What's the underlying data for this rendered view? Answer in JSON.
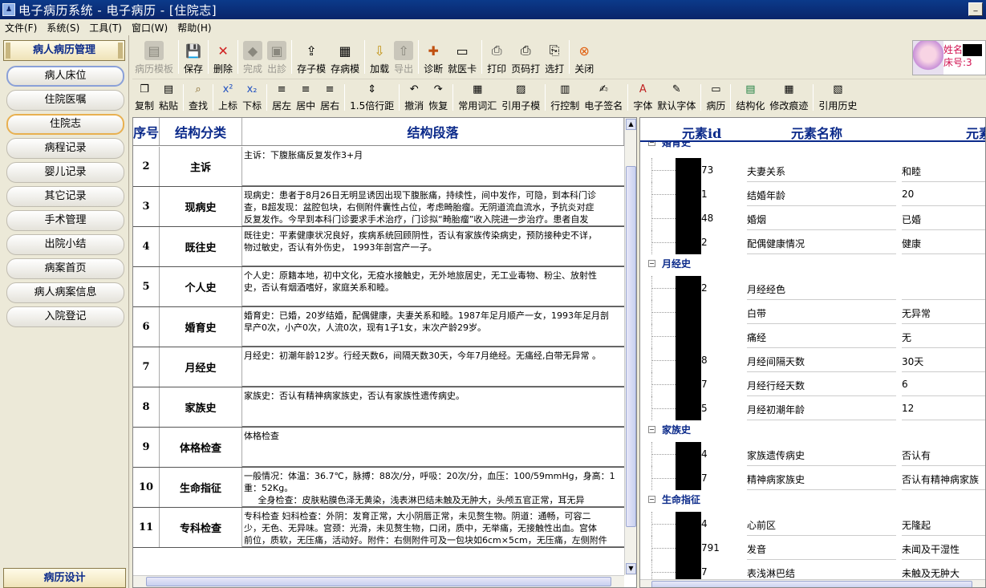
{
  "window": {
    "title": "电子病历系统 - 电子病历 - [住院志]",
    "app_icon": "app-icon"
  },
  "menu": [
    "文件(F)",
    "系统(S)",
    "工具(T)",
    "窗口(W)",
    "帮助(H)"
  ],
  "sidebar": {
    "header": "病人病历管理",
    "items": [
      {
        "label": "病人床位",
        "state": "hover"
      },
      {
        "label": "住院医嘱",
        "state": "normal"
      },
      {
        "label": "住院志",
        "state": "selected"
      },
      {
        "label": "病程记录",
        "state": "normal"
      },
      {
        "label": "婴儿记录",
        "state": "normal"
      },
      {
        "label": "其它记录",
        "state": "normal"
      },
      {
        "label": "手术管理",
        "state": "normal"
      },
      {
        "label": "出院小结",
        "state": "normal"
      },
      {
        "label": "病案首页",
        "state": "normal"
      },
      {
        "label": "病人病案信息",
        "state": "normal"
      },
      {
        "label": "入院登记",
        "state": "normal"
      }
    ],
    "footer": "病历设计"
  },
  "toolbar1": [
    {
      "label": "病历模板",
      "icon": "template-icon",
      "disabled": true
    },
    {
      "label": "保存",
      "icon": "save-icon",
      "disabled": false
    },
    {
      "label": "删除",
      "icon": "delete-icon",
      "disabled": false
    },
    {
      "label": "完成",
      "icon": "complete-icon",
      "disabled": true
    },
    {
      "label": "出診",
      "icon": "visit-icon",
      "disabled": true
    },
    {
      "label": "存子模",
      "icon": "save-subtemplate-icon",
      "disabled": false
    },
    {
      "label": "存病模",
      "icon": "save-casetemplate-icon",
      "disabled": false
    },
    {
      "label": "加载",
      "icon": "load-icon",
      "disabled": false
    },
    {
      "label": "导出",
      "icon": "export-icon",
      "disabled": true
    },
    {
      "label": "诊断",
      "icon": "diagnosis-icon",
      "disabled": false
    },
    {
      "label": "就医卡",
      "icon": "medical-card-icon",
      "disabled": false
    },
    {
      "label": "打印",
      "icon": "print-icon",
      "disabled": false
    },
    {
      "label": "页码打",
      "icon": "page-print-icon",
      "disabled": false
    },
    {
      "label": "选打",
      "icon": "select-print-icon",
      "disabled": false
    },
    {
      "label": "关闭",
      "icon": "close-icon",
      "disabled": false
    }
  ],
  "toolbar2": [
    {
      "label": "复制",
      "icon": "copy-icon"
    },
    {
      "label": "粘贴",
      "icon": "paste-icon"
    },
    {
      "label": "查找",
      "icon": "find-icon"
    },
    {
      "label": "上标",
      "icon": "superscript-icon"
    },
    {
      "label": "下标",
      "icon": "subscript-icon"
    },
    {
      "label": "居左",
      "icon": "align-left-icon"
    },
    {
      "label": "居中",
      "icon": "align-center-icon"
    },
    {
      "label": "居右",
      "icon": "align-right-icon"
    },
    {
      "label": "1.5倍行距",
      "icon": "line-spacing-icon"
    },
    {
      "label": "撤消",
      "icon": "undo-icon"
    },
    {
      "label": "恢复",
      "icon": "redo-icon"
    },
    {
      "label": "常用词汇",
      "icon": "vocabulary-icon"
    },
    {
      "label": "引用子模",
      "icon": "cite-subtemplate-icon"
    },
    {
      "label": "行控制",
      "icon": "row-control-icon"
    },
    {
      "label": "电子签名",
      "icon": "e-signature-icon"
    },
    {
      "label": "字体",
      "icon": "font-icon"
    },
    {
      "label": "默认字体",
      "icon": "default-font-icon"
    },
    {
      "label": "病历",
      "icon": "record-folder-icon"
    },
    {
      "label": "结构化",
      "icon": "structured-icon"
    },
    {
      "label": "修改痕迹",
      "icon": "revision-trace-icon"
    },
    {
      "label": "引用历史",
      "icon": "cite-history-icon"
    }
  ],
  "patient": {
    "name_label": "姓名",
    "bed_label": "床号:3"
  },
  "left_table": {
    "headers": [
      "序号",
      "结构分类",
      "结构段落"
    ],
    "rows": [
      {
        "n": "2",
        "k": "主诉",
        "t": "主诉：下腹胀痛反复发作3+月"
      },
      {
        "n": "3",
        "k": "现病史",
        "t": "现病史：患者于8月26日无明显诱因出现下腹胀痛，持续性，间中发作，可隐，到本科门诊\n查，B超发现：盆腔包块，右侧附件囊性占位，考虑畸胎瘤。无阴道流血流水，予抗炎对症\n反复发作。今早到本科门诊要求手术治疗，门诊拟“畸胎瘤”收入院进一步治疗。患者自发"
      },
      {
        "n": "4",
        "k": "既往史",
        "t": "既往史：平素健康状况良好，疾病系统回顾阴性，否认有家族传染病史，预防接种史不详，\n物过敏史，否认有外伤史， 1993年剖宫产一子。"
      },
      {
        "n": "5",
        "k": "个人史",
        "t": "个人史：原籍本地，初中文化，无疫水接触史，无外地旅居史，无工业毒物、粉尘、放射性\n史，否认有烟酒嗜好，家庭关系和睦。"
      },
      {
        "n": "6",
        "k": "婚育史",
        "t": "婚育史：已婚，20岁结婚，配偶健康，夫妻关系和睦。1987年足月顺产一女，1993年足月剖\n早产0次，小产0次，人流0次，现有1子1女，末次产龄29岁。"
      },
      {
        "n": "7",
        "k": "月经史",
        "t": "月经史：初潮年龄12岁。行经天数6，间隔天数30天，今年7月绝经。无痛经,白带无异常 。"
      },
      {
        "n": "8",
        "k": "家族史",
        "t": "家族史：否认有精神病家族史，否认有家族性遗传病史。"
      },
      {
        "n": "9",
        "k": "体格检查",
        "t": "体格检查"
      },
      {
        "n": "10",
        "k": "生命指征",
        "t": "一般情况：体温：36.7℃，脉搏：88次/分，呼吸：20次/分，血压：100/59mmHg，身高：1\n重：52Kg。\n     全身检查：皮肤粘膜色泽无黄染，浅表淋巴结未触及无肿大，头颅五官正常，耳无异"
      },
      {
        "n": "11",
        "k": "专科检查",
        "t": "专科检查 妇科检查：外阴：发育正常，大小阴唇正常，未见赘生物。阴道：通畅，可容二\n少，无色、无异味。宫颈：光滑，未见赘生物，口闭，质中，无举痛，无接触性出血。宫体\n前位，质软，无压痛，活动好。附件：右侧附件可及一包块如6cm×5cm，无压痛，左侧附件"
      }
    ]
  },
  "right_table": {
    "headers": [
      "元素id",
      "元素名称",
      "元素"
    ],
    "groups": [
      {
        "name": "婚育史",
        "items": [
          {
            "id": "73",
            "name": "夫妻关系",
            "value": "和睦"
          },
          {
            "id": "1",
            "name": "结婚年龄",
            "value": "20"
          },
          {
            "id": "48",
            "name": "婚烟",
            "value": "已婚"
          },
          {
            "id": "2",
            "name": "配偶健康情况",
            "value": "健康"
          }
        ]
      },
      {
        "name": "月经史",
        "items": [
          {
            "id": "2",
            "name": "月经经色",
            "value": ""
          },
          {
            "id": "",
            "name": "白带",
            "value": "无异常"
          },
          {
            "id": "",
            "name": "痛经",
            "value": "无"
          },
          {
            "id": "8",
            "name": "月经间隔天数",
            "value": "30天"
          },
          {
            "id": "7",
            "name": "月经行经天数",
            "value": "6"
          },
          {
            "id": "5",
            "name": "月经初潮年龄",
            "value": "12"
          }
        ]
      },
      {
        "name": "家族史",
        "items": [
          {
            "id": "4",
            "name": "家族遗传病史",
            "value": "否认有"
          },
          {
            "id": "7",
            "name": "精神病家族史",
            "value": "否认有精神病家族"
          }
        ]
      },
      {
        "name": "生命指征",
        "items": [
          {
            "id": "4",
            "name": "心前区",
            "value": "无隆起"
          },
          {
            "id": "791",
            "name": "发音",
            "value": "未闻及干湿性"
          },
          {
            "id": "7",
            "name": "表浅淋巴结",
            "value": "未触及无肿大"
          }
        ]
      }
    ]
  }
}
